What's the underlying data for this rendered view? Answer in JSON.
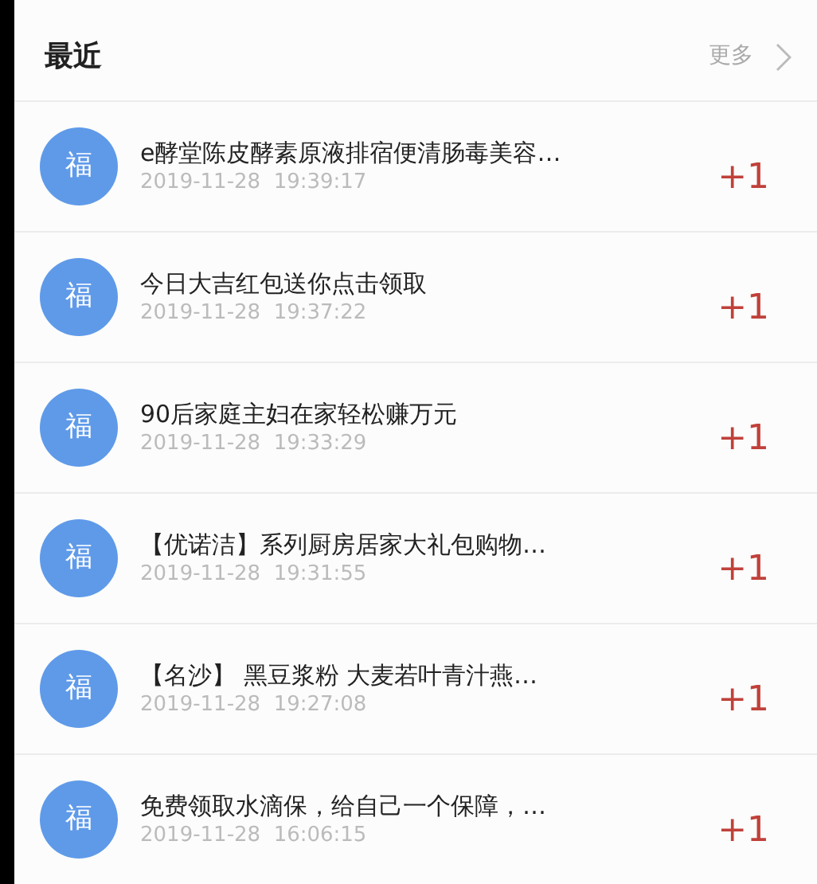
{
  "header": {
    "title": "最近",
    "more": "更多"
  },
  "items": [
    {
      "avatar": "福",
      "title": "e酵堂陈皮酵素原液排宿便清肠毒美容…",
      "time": "2019-11-28  19:39:17",
      "badge": "+1"
    },
    {
      "avatar": "福",
      "title": "今日大吉红包送你点击领取",
      "time": "2019-11-28  19:37:22",
      "badge": "+1"
    },
    {
      "avatar": "福",
      "title": "90后家庭主妇在家轻松赚万元",
      "time": "2019-11-28  19:33:29",
      "badge": "+1"
    },
    {
      "avatar": "福",
      "title": "【优诺洁】系列厨房居家大礼包购物…",
      "time": "2019-11-28  19:31:55",
      "badge": "+1"
    },
    {
      "avatar": "福",
      "title": "【名沙】 黑豆浆粉 大麦若叶青汁燕…",
      "time": "2019-11-28  19:27:08",
      "badge": "+1"
    },
    {
      "avatar": "福",
      "title": "免费领取水滴保，给自己一个保障，…",
      "time": "2019-11-28  16:06:15",
      "badge": "+1"
    }
  ]
}
